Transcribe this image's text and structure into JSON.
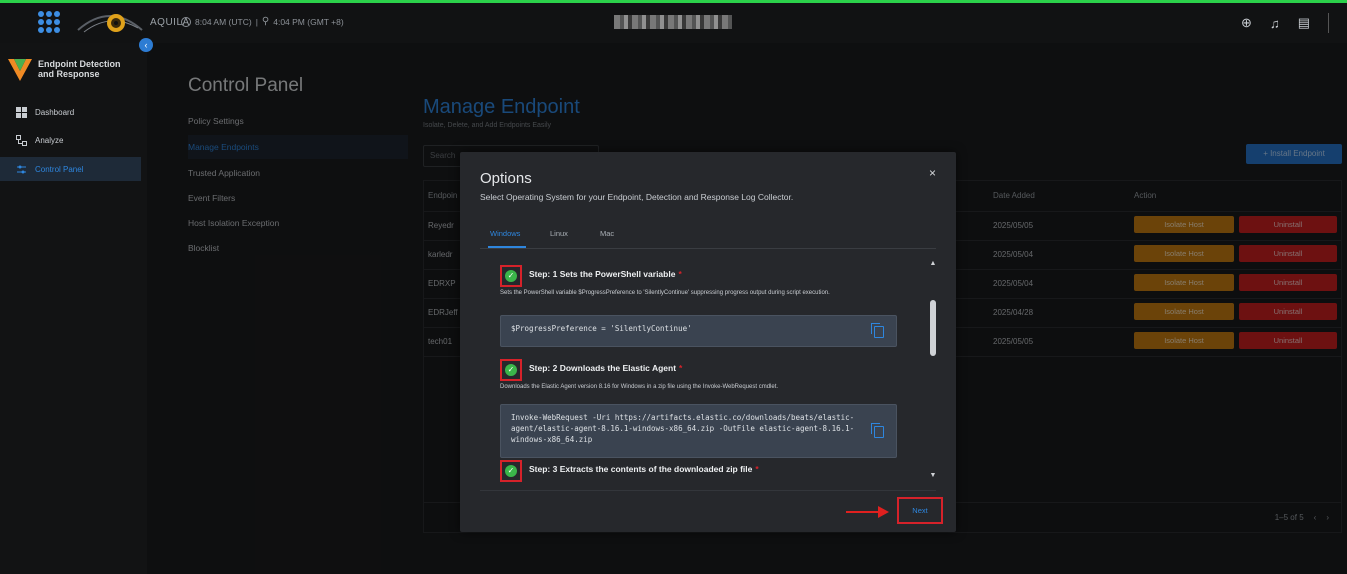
{
  "topbar": {
    "brand": "AQUILA",
    "time_utc": "8:04 AM (UTC)",
    "time_local": "4:04 PM (GMT +8)"
  },
  "sidebar": {
    "product_title": "Endpoint Detection and Response",
    "items": [
      {
        "label": "Dashboard",
        "icon": "dashboard-icon"
      },
      {
        "label": "Analyze",
        "icon": "analyze-icon"
      },
      {
        "label": "Control Panel",
        "icon": "control-panel-icon",
        "active": true
      }
    ]
  },
  "control_panel": {
    "title": "Control Panel",
    "items": [
      {
        "label": "Policy Settings"
      },
      {
        "label": "Manage Endpoints",
        "active": true
      },
      {
        "label": "Trusted Application"
      },
      {
        "label": "Event Filters"
      },
      {
        "label": "Host Isolation Exception"
      },
      {
        "label": "Blocklist"
      }
    ]
  },
  "main": {
    "title": "Manage Endpoint",
    "subtitle": "Isolate, Delete, and Add Endpoints Easily",
    "search_placeholder": "Search",
    "install_button": "+ Install Endpoint",
    "table": {
      "headers": {
        "endpoint": "Endpoin",
        "date_added": "Date Added",
        "action": "Action"
      },
      "rows": [
        {
          "endpoint": "Reyedr",
          "date": "2025/05/05"
        },
        {
          "endpoint": "karledr",
          "date": "2025/05/04"
        },
        {
          "endpoint": "EDRXP",
          "date": "2025/05/04"
        },
        {
          "endpoint": "EDRJeff",
          "date": "2025/04/28"
        },
        {
          "endpoint": "tech01",
          "date": "2025/05/05"
        }
      ],
      "isolate_label": "Isolate Host",
      "uninstall_label": "Uninstall",
      "pagination": "1–5 of 5"
    }
  },
  "modal": {
    "title": "Options",
    "subtitle": "Select Operating System for your Endpoint, Detection and Response Log Collector.",
    "close": "×",
    "tabs": [
      {
        "label": "Windows",
        "active": true
      },
      {
        "label": "Linux"
      },
      {
        "label": "Mac"
      }
    ],
    "steps": [
      {
        "title": "Step: 1 Sets the PowerShell variable",
        "desc": "Sets the PowerShell variable $ProgressPreference to 'SilentlyContinue' suppressing progress output during script execution.",
        "code": "$ProgressPreference = 'SilentlyContinue'"
      },
      {
        "title": "Step: 2 Downloads the Elastic Agent",
        "desc": "Downloads the Elastic Agent version 8.16 for Windows in a zip file using the Invoke-WebRequest cmdlet.",
        "code": "Invoke-WebRequest -Uri https://artifacts.elastic.co/downloads/beats/elastic-agent/elastic-agent-8.16.1-windows-x86_64.zip -OutFile elastic-agent-8.16.1-windows-x86_64.zip"
      },
      {
        "title": "Step: 3 Extracts the contents of the downloaded zip file"
      }
    ],
    "next_button": "Next",
    "required_mark": "*"
  },
  "colors": {
    "accent": "#2e86de",
    "isolate": "#c47a12",
    "uninstall": "#c61f1f",
    "check": "#3bb54a",
    "highlight": "#d6222a"
  }
}
